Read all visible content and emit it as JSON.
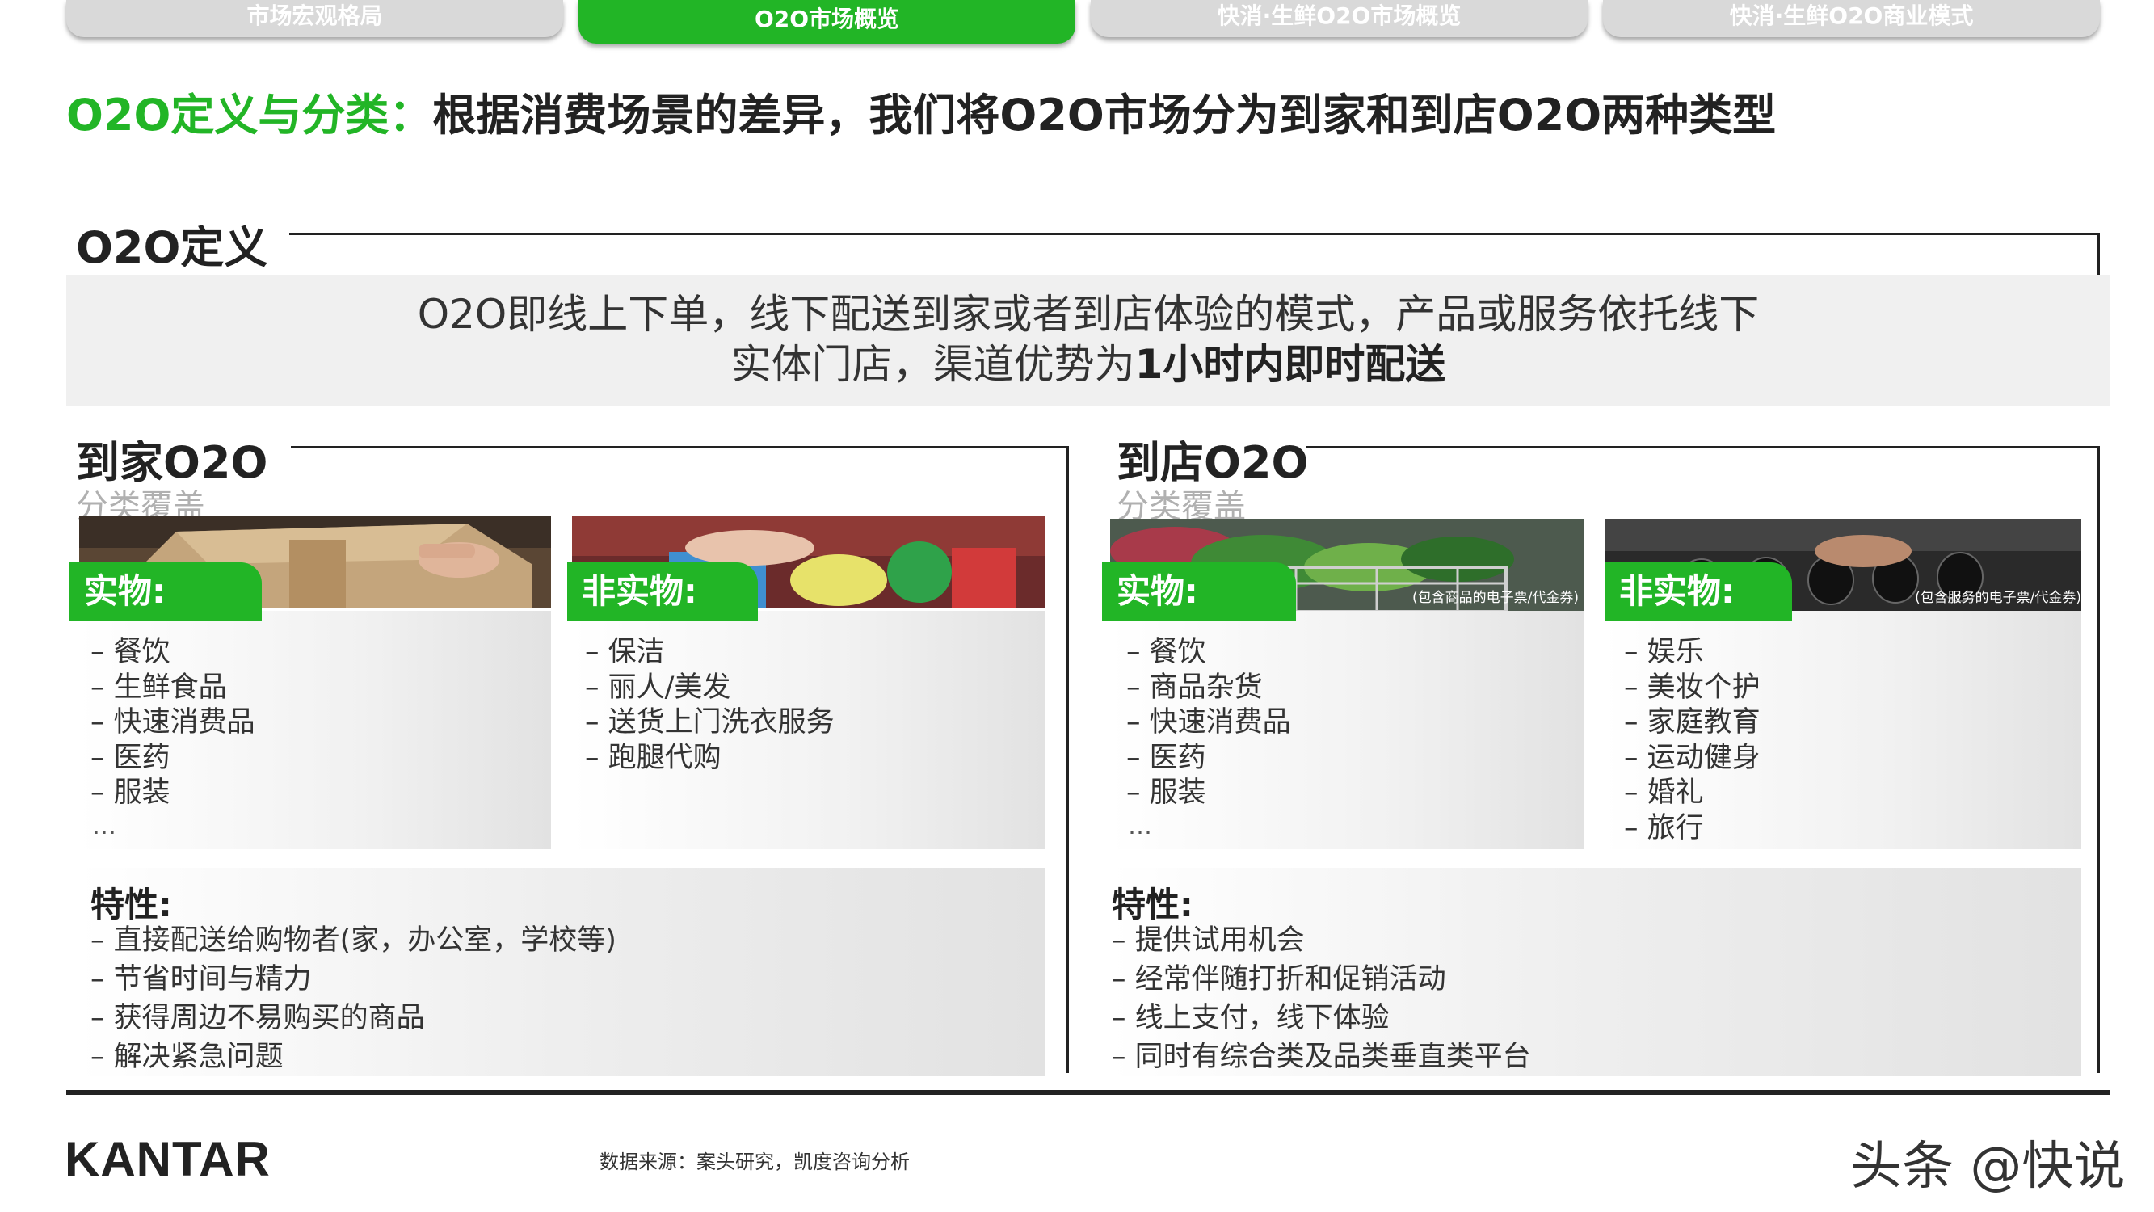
{
  "tabs": [
    {
      "label": "市场宏观格局"
    },
    {
      "label": "O2O市场概览"
    },
    {
      "label": "快消·生鲜O2O市场概览"
    },
    {
      "label": "快消·生鲜O2O商业模式"
    }
  ],
  "title": {
    "highlight": "O2O定义与分类：",
    "rest": "根据消费场景的差异，我们将O2O市场分为到家和到店O2O两种类型"
  },
  "definition": {
    "heading": "O2O定义",
    "line1": "O2O即线上下单，线下配送到家或者到店体验的模式，产品或服务依托线下",
    "line2_prefix": "实体门店，渠道优势为",
    "line2_bold": "1小时内即时配送"
  },
  "home": {
    "heading": "到家O2O",
    "caption": "分类覆盖",
    "physical": {
      "tag": "实物:",
      "items": [
        "餐饮",
        "生鲜食品",
        "快速消费品",
        "医药",
        "服装"
      ],
      "ellipsis": "…"
    },
    "nonphysical": {
      "tag": "非实物:",
      "items": [
        "保洁",
        "丽人/美发",
        "送货上门洗衣服务",
        "跑腿代购"
      ]
    },
    "traits": {
      "title": "特性:",
      "items": [
        "直接配送给购物者(家，办公室，学校等)",
        "节省时间与精力",
        "获得周边不易购买的商品",
        "解决紧急问题"
      ]
    }
  },
  "store": {
    "heading": "到店O2O",
    "caption": "分类覆盖",
    "physical": {
      "tag": "实物:",
      "note": "(包含商品的电子票/代金券)",
      "items": [
        "餐饮",
        "商品杂货",
        "快速消费品",
        "医药",
        "服装"
      ],
      "ellipsis": "…"
    },
    "nonphysical": {
      "tag": "非实物:",
      "note": "(包含服务的电子票/代金券)",
      "items": [
        "娱乐",
        "美妆个护",
        "家庭教育",
        "运动健身",
        "婚礼",
        "旅行"
      ]
    },
    "traits": {
      "title": "特性:",
      "items": [
        "提供试用机会",
        "经常伴随打折和促销活动",
        "线上支付，线下体验",
        "同时有综合类及品类垂直类平台"
      ]
    }
  },
  "footer": {
    "logo": "KANTAR",
    "source": "数据来源：案头研究，凯度咨询分析",
    "watermark": "头条 @快说"
  },
  "colors": {
    "accent": "#22b526",
    "text": "#222222",
    "panel": "#f0f0f0"
  }
}
